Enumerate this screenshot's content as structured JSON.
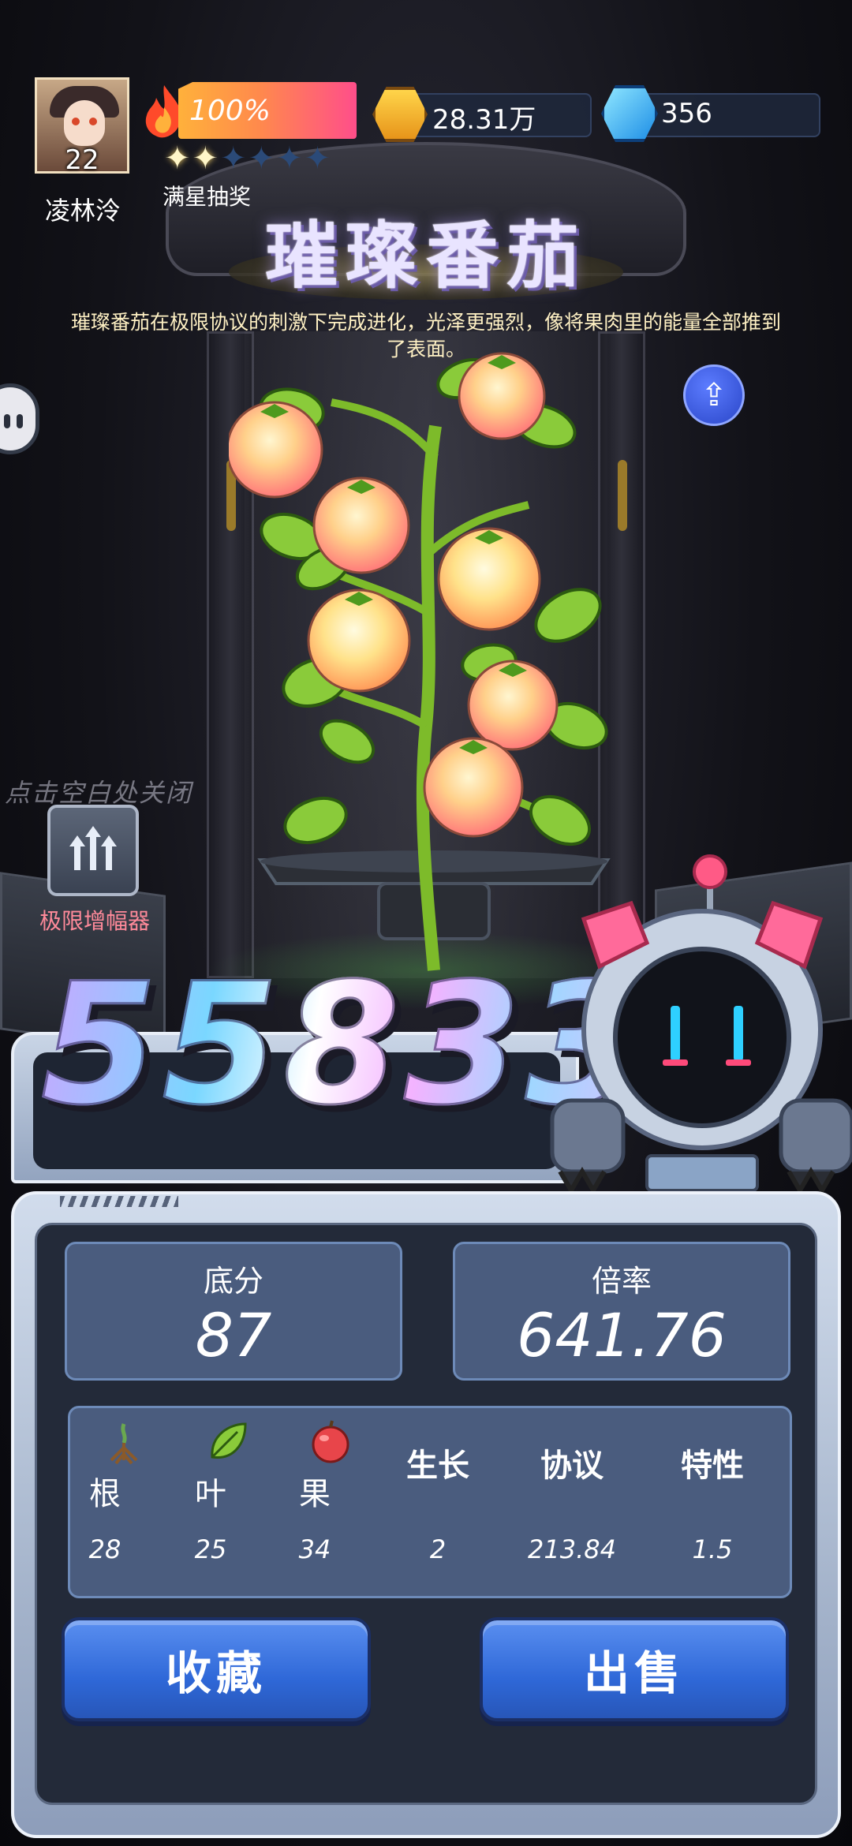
{
  "player": {
    "level": "22",
    "name": "凌林泠"
  },
  "energy": {
    "percent_text": "100%",
    "stars_filled": 2,
    "stars_total": 6,
    "caption": "满星抽奖"
  },
  "resources": {
    "gold": "28.31万",
    "gems": "356"
  },
  "item": {
    "title": "璀璨番茄",
    "description": "璀璨番茄在极限协议的刺激下完成进化，光泽更强烈，像将果肉里的能量全部推到了表面。"
  },
  "hint": {
    "tap_close": "点击空白处关闭"
  },
  "amplifier": {
    "label": "极限增幅器"
  },
  "score": {
    "total": "55833"
  },
  "stats": {
    "base_label": "底分",
    "base_value": "87",
    "multiplier_label": "倍率",
    "multiplier_value": "641.76"
  },
  "details": [
    {
      "label": "根",
      "value": "28",
      "icon": "root-icon"
    },
    {
      "label": "叶",
      "value": "25",
      "icon": "leaf-icon"
    },
    {
      "label": "果",
      "value": "34",
      "icon": "fruit-icon"
    },
    {
      "label": "生长",
      "value": "2",
      "icon": ""
    },
    {
      "label": "协议",
      "value": "213.84",
      "icon": ""
    },
    {
      "label": "特性",
      "value": "1.5",
      "icon": ""
    }
  ],
  "actions": {
    "collect_label": "收藏",
    "sell_label": "出售"
  },
  "colors": {
    "button_blue": "#2f68d8",
    "panel_blue": "#4a5c7e",
    "amplifier_label": "#ff8a9a"
  }
}
